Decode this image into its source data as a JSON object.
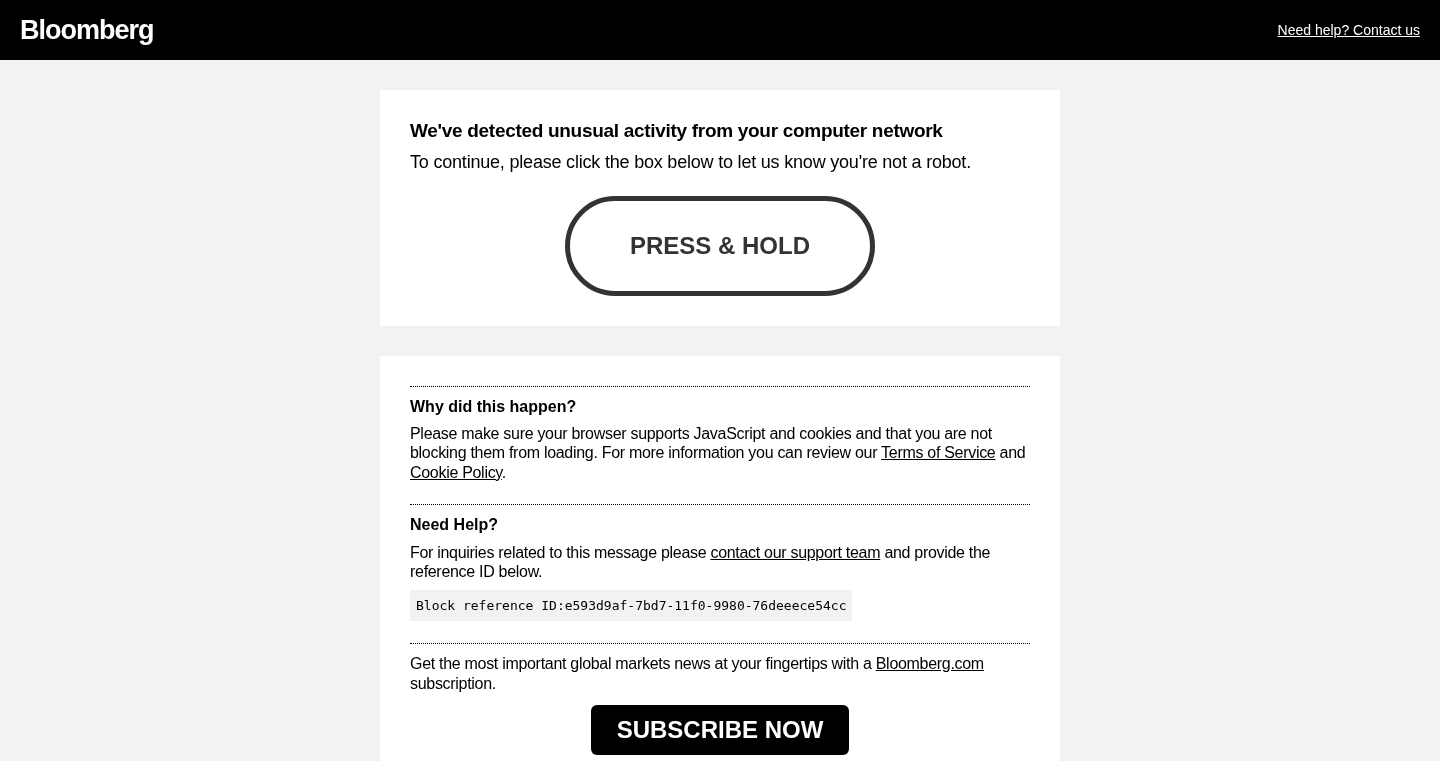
{
  "header": {
    "logo": "Bloomberg",
    "help_link": "Need help? Contact us"
  },
  "challenge": {
    "title": "We've detected unusual activity from your computer network",
    "instruction": "To continue, please click the box below to let us know you're not a robot.",
    "button": "PRESS & HOLD"
  },
  "sections": [
    {
      "heading": "Why did this happen?",
      "paragraph": [
        {
          "kind": "text",
          "text": "Please make sure your browser supports JavaScript and cookies and that you are not blocking them from loading. For more information you can review our "
        },
        {
          "kind": "link",
          "text": "Terms of Service"
        },
        {
          "kind": "text",
          "text": " and "
        },
        {
          "kind": "link",
          "text": "Cookie Policy"
        },
        {
          "kind": "text",
          "text": "."
        }
      ]
    },
    {
      "heading": "Need Help?",
      "paragraph": [
        {
          "kind": "text",
          "text": "For inquiries related to this message please "
        },
        {
          "kind": "link",
          "text": "contact our support team"
        },
        {
          "kind": "text",
          "text": " and provide the reference ID below."
        }
      ],
      "reference": "Block reference ID:e593d9af-7bd7-11f0-9980-76deeece54cc"
    },
    {
      "paragraph": [
        {
          "kind": "text",
          "text": "Get the most important global markets news at your fingertips with a "
        },
        {
          "kind": "link",
          "text": "Bloomberg.com"
        },
        {
          "kind": "text",
          "text": " subscription."
        }
      ],
      "button": "SUBSCRIBE NOW"
    }
  ]
}
